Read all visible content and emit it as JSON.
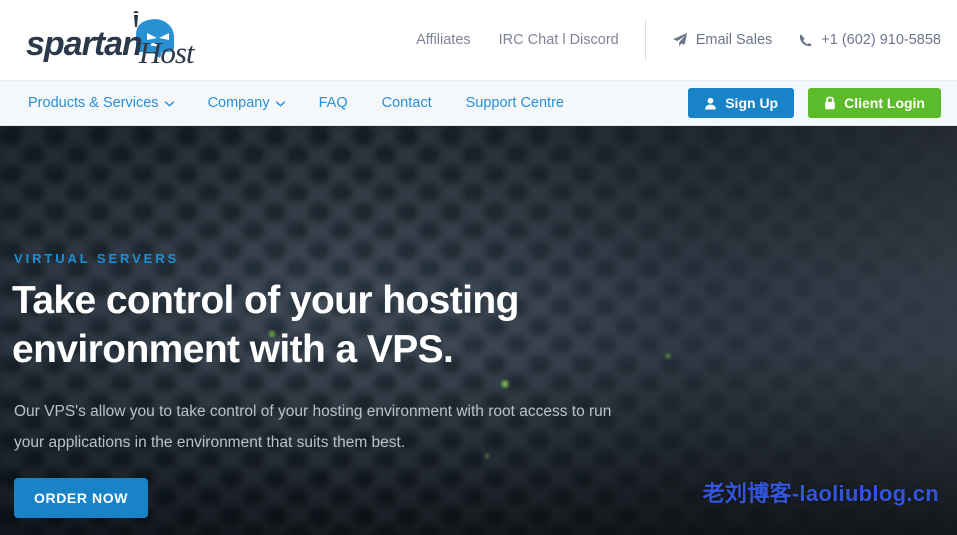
{
  "brand": {
    "name": "spartanHost",
    "word_one": "spartan",
    "word_two": "Host",
    "helmet_icon": "spartan-helmet-icon",
    "blue": "#2a90d4",
    "dark": "#2b3a4a"
  },
  "topbar": {
    "links": [
      {
        "label": "Affiliates",
        "name": "affiliates"
      },
      {
        "label": "IRC Chat l Discord",
        "name": "irc-chat-discord"
      }
    ],
    "contacts": [
      {
        "label": "Email Sales",
        "icon": "paper-plane-icon",
        "name": "email-sales"
      },
      {
        "label": "+1 (602) 910-5858",
        "icon": "phone-icon",
        "name": "phone-number"
      }
    ]
  },
  "mainnav": {
    "links": [
      {
        "label": "Products & Services",
        "name": "products-services",
        "caret": true
      },
      {
        "label": "Company",
        "name": "company",
        "caret": true
      },
      {
        "label": "FAQ",
        "name": "faq",
        "caret": false
      },
      {
        "label": "Contact",
        "name": "contact",
        "caret": false
      },
      {
        "label": "Support Centre",
        "name": "support-centre",
        "caret": false
      }
    ],
    "signup_label": "Sign Up",
    "signup_icon": "user-icon",
    "signup_color": "#1884c7",
    "login_label": "Client Login",
    "login_icon": "lock-icon",
    "login_color": "#5cbb2b"
  },
  "hero": {
    "eyebrow": "VIRTUAL SERVERS",
    "eyebrow_color": "#1d8fd6",
    "title": "Take control of your hosting environment with a VPS.",
    "subtitle": "Our VPS's allow you to take control of your hosting environment with root access to run your applications in the environment that suits them best.",
    "cta_label": "ORDER NOW",
    "cta_color": "#1884c7",
    "background": "blurred perforated metal server mesh, dark blue-grey"
  },
  "watermark": {
    "text": "老刘博客-laoliublog.cn",
    "color": "#3355dd"
  }
}
